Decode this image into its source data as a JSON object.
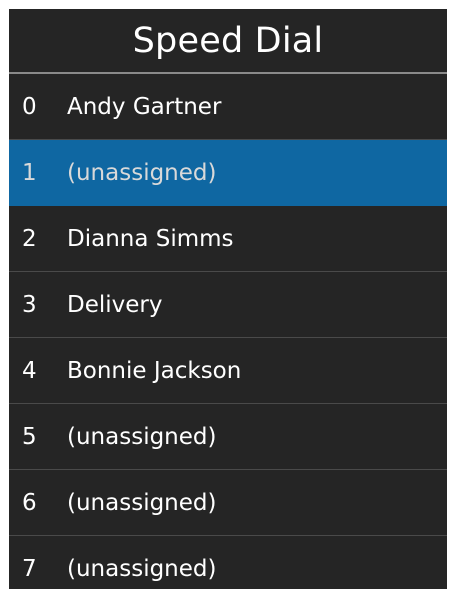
{
  "title": "Speed Dial",
  "selected_index": 1,
  "colors": {
    "background": "#252525",
    "selected": "#0f67a2",
    "text": "#ffffff"
  },
  "entries": [
    {
      "number": "0",
      "name": "Andy Gartner"
    },
    {
      "number": "1",
      "name": "(unassigned)"
    },
    {
      "number": "2",
      "name": "Dianna Simms"
    },
    {
      "number": "3",
      "name": "Delivery"
    },
    {
      "number": "4",
      "name": "Bonnie Jackson"
    },
    {
      "number": "5",
      "name": "(unassigned)"
    },
    {
      "number": "6",
      "name": "(unassigned)"
    },
    {
      "number": "7",
      "name": "(unassigned)"
    }
  ]
}
